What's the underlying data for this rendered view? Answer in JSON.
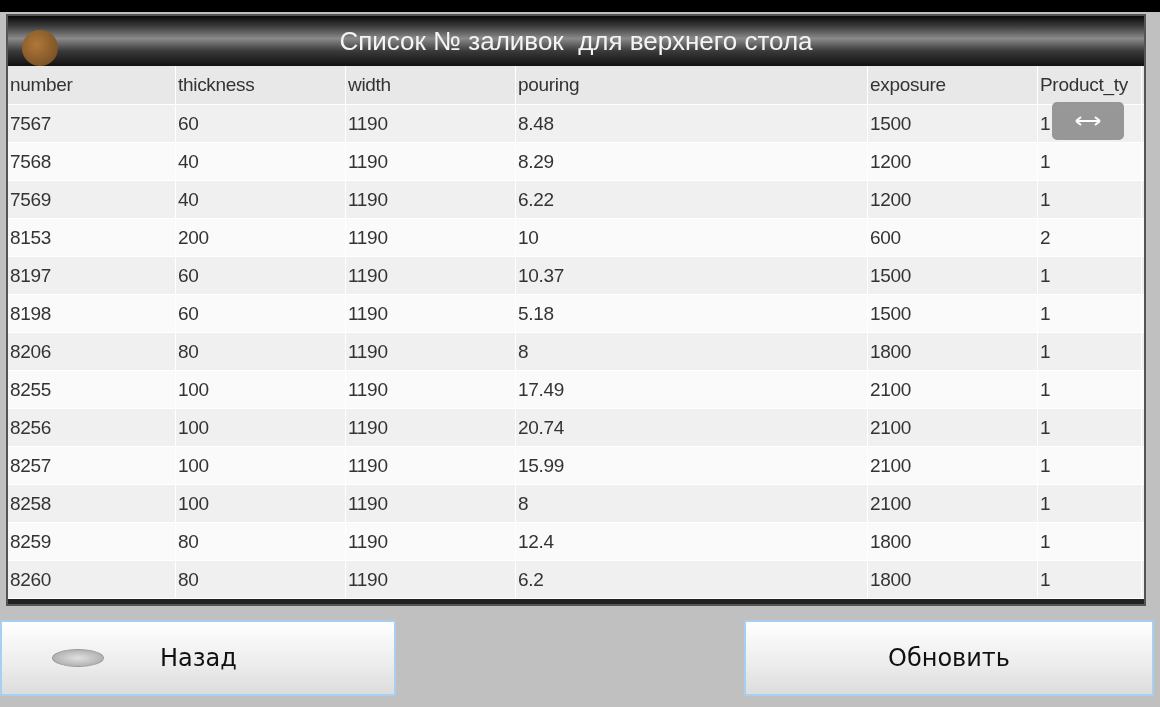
{
  "window": {
    "title": "Список № заливок  для верхнего стола"
  },
  "table": {
    "columns": [
      "number",
      "thickness",
      "width",
      "pouring",
      "exposure",
      "Product_ty"
    ],
    "rows": [
      [
        "7567",
        "60",
        "1190",
        "8.48",
        "1500",
        "1"
      ],
      [
        "7568",
        "40",
        "1190",
        "8.29",
        "1200",
        "1"
      ],
      [
        "7569",
        "40",
        "1190",
        "6.22",
        "1200",
        "1"
      ],
      [
        "8153",
        "200",
        "1190",
        "10",
        "600",
        "2"
      ],
      [
        "8197",
        "60",
        "1190",
        "10.37",
        "1500",
        "1"
      ],
      [
        "8198",
        "60",
        "1190",
        "5.18",
        "1500",
        "1"
      ],
      [
        "8206",
        "80",
        "1190",
        "8",
        "1800",
        "1"
      ],
      [
        "8255",
        "100",
        "1190",
        "17.49",
        "2100",
        "1"
      ],
      [
        "8256",
        "100",
        "1190",
        "20.74",
        "2100",
        "1"
      ],
      [
        "8257",
        "100",
        "1190",
        "15.99",
        "2100",
        "1"
      ],
      [
        "8258",
        "100",
        "1190",
        "8",
        "2100",
        "1"
      ],
      [
        "8259",
        "80",
        "1190",
        "12.4",
        "1800",
        "1"
      ],
      [
        "8260",
        "80",
        "1190",
        "6.2",
        "1800",
        "1"
      ]
    ]
  },
  "buttons": [
    {
      "label": "Назад",
      "kind": "back"
    },
    {
      "label": "Обновить",
      "kind": "plain"
    }
  ]
}
